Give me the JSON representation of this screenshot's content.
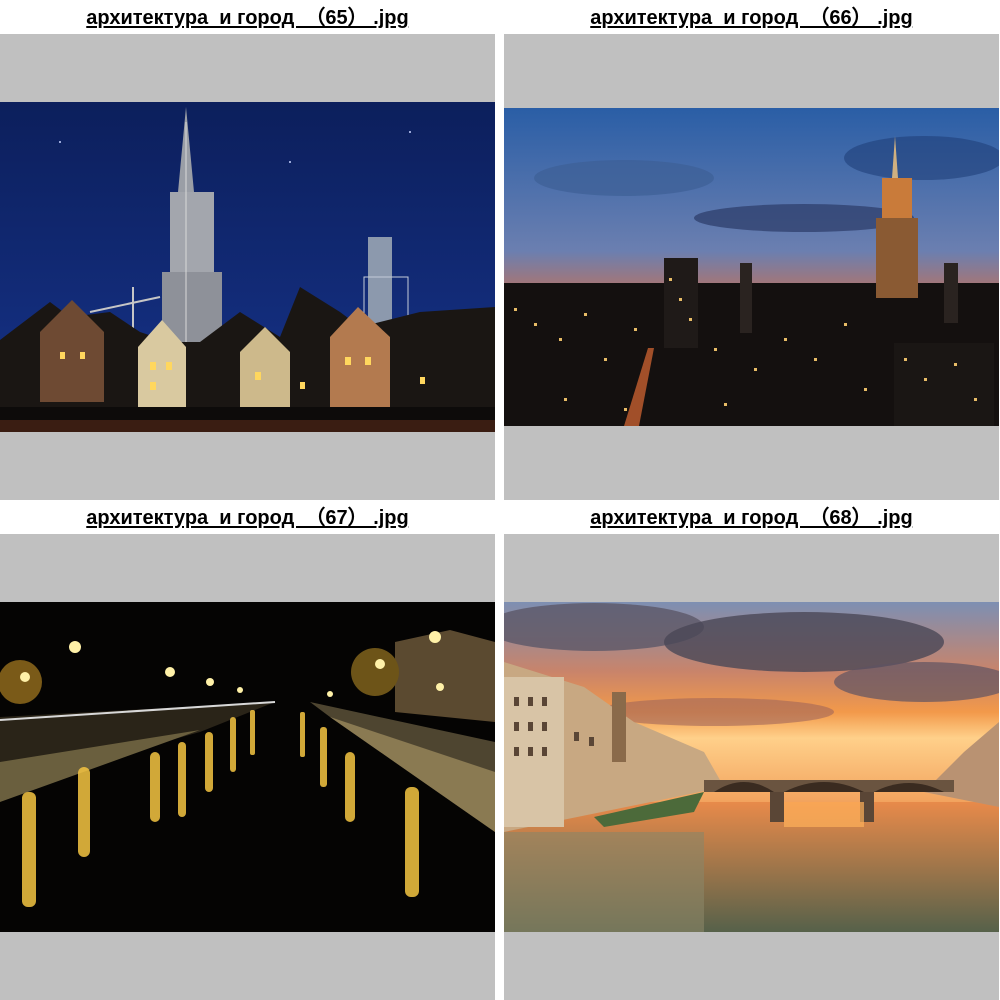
{
  "gallery": {
    "items": [
      {
        "caption": "архитектура  и город  （65） .jpg",
        "subject": "cathedral-night"
      },
      {
        "caption": "архитектура  и город  （66） .jpg",
        "subject": "skyline-sunset"
      },
      {
        "caption": "архитектура  и город  （67） .jpg",
        "subject": "canal-night-lights"
      },
      {
        "caption": "архитектура  и город  （68） .jpg",
        "subject": "river-bridge-sunset"
      }
    ]
  },
  "colors": {
    "frame_background": "#c0c0c0",
    "page_background": "#ffffff",
    "caption_text": "#000000"
  }
}
